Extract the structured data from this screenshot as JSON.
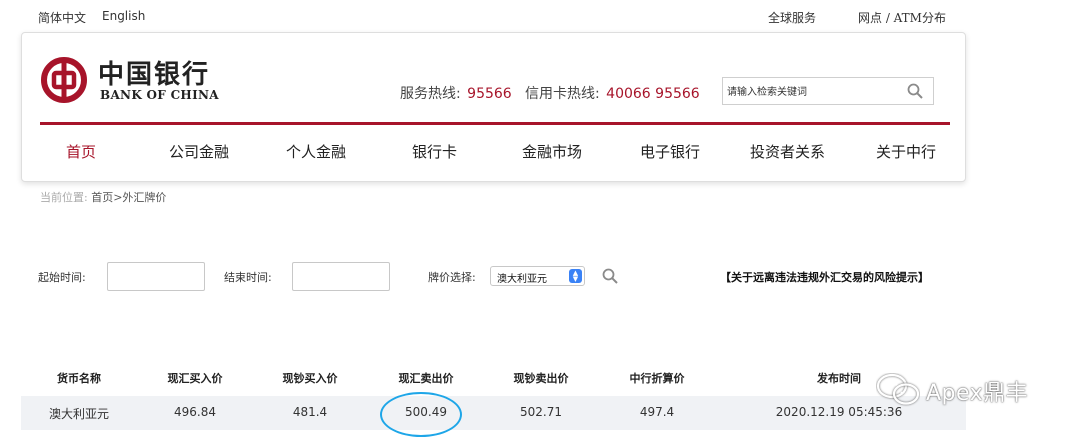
{
  "topbar": {
    "lang_cn": "简体中文",
    "lang_en": "English",
    "global_service": "全球服务",
    "branches": "网点 / ATM分布"
  },
  "logo": {
    "cn": "中国银行",
    "en": "BANK OF CHINA"
  },
  "hotlines": {
    "service_label": "服务热线:",
    "service_number": "95566",
    "credit_label": "信用卡热线:",
    "credit_number": "40066 95566"
  },
  "search": {
    "placeholder": "请输入检索关键词"
  },
  "nav": {
    "items": [
      "首页",
      "公司金融",
      "个人金融",
      "银行卡",
      "金融市场",
      "电子银行",
      "投资者关系",
      "关于中行"
    ]
  },
  "breadcrumb": {
    "prefix": "当前位置:",
    "path": "首页>外汇牌价"
  },
  "filter": {
    "start_label": "起始时间:",
    "end_label": "结束时间:",
    "price_label": "牌价选择:",
    "currency_selected": "澳大利亚元",
    "risk_link": "【关于远离违法违规外汇交易的风险提示】"
  },
  "table": {
    "headers": [
      "货币名称",
      "现汇买入价",
      "现钞买入价",
      "现汇卖出价",
      "现钞卖出价",
      "中行折算价",
      "发布时间"
    ],
    "rows": [
      [
        "澳大利亚元",
        "496.84",
        "481.4",
        "500.49",
        "502.71",
        "497.4",
        "2020.12.19 05:45:36"
      ]
    ]
  },
  "watermark": {
    "text": "Apex鼎丰"
  },
  "colors": {
    "brand_red": "#a7142a",
    "highlight_blue": "#1ea6e8",
    "select_blue": "#3a82f6"
  }
}
